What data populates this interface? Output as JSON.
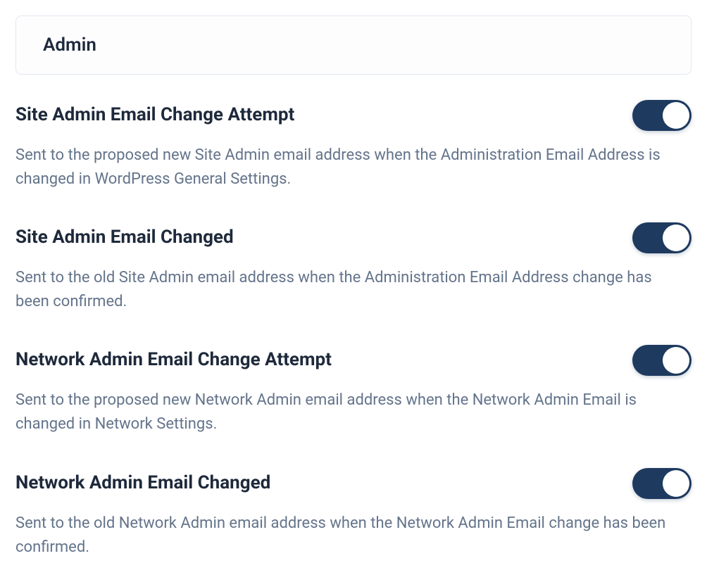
{
  "section": {
    "title": "Admin"
  },
  "settings": [
    {
      "id": "site-admin-email-change-attempt",
      "title": "Site Admin Email Change Attempt",
      "description": "Sent to the proposed new Site Admin email address when the Administration Email Address is changed in WordPress General Settings.",
      "enabled": true
    },
    {
      "id": "site-admin-email-changed",
      "title": "Site Admin Email Changed",
      "description": "Sent to the old Site Admin email address when the Administration Email Address change has been confirmed.",
      "enabled": true
    },
    {
      "id": "network-admin-email-change-attempt",
      "title": "Network Admin Email Change Attempt",
      "description": "Sent to the proposed new Network Admin email address when the Network Admin Email is changed in Network Settings.",
      "enabled": true
    },
    {
      "id": "network-admin-email-changed",
      "title": "Network Admin Email Changed",
      "description": "Sent to the old Network Admin email address when the Network Admin Email change has been confirmed.",
      "enabled": true
    }
  ]
}
